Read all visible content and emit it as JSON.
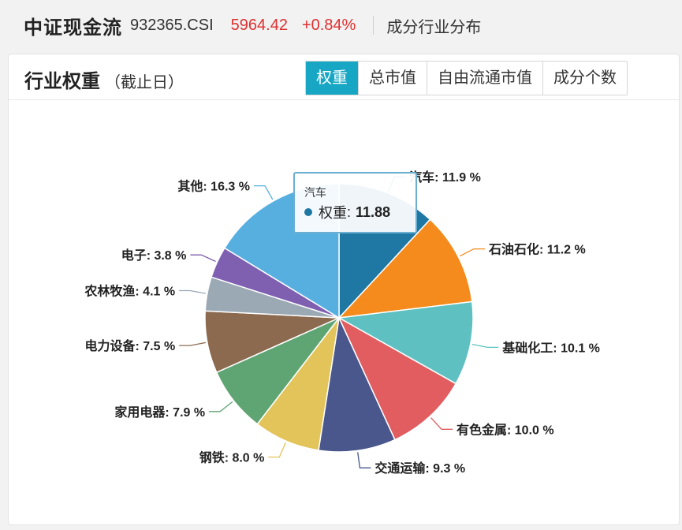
{
  "header": {
    "index_name": "中证现金流",
    "index_code": "932365.CSI",
    "price": "5964.42",
    "change": "+0.84%",
    "section": "成分行业分布"
  },
  "panel": {
    "title": "行业权重",
    "subtitle": "（截止日）",
    "tabs": [
      {
        "label": "权重",
        "active": true
      },
      {
        "label": "总市值",
        "active": false
      },
      {
        "label": "自由流通市值",
        "active": false
      },
      {
        "label": "成分个数",
        "active": false
      }
    ]
  },
  "tooltip": {
    "category": "汽车",
    "series_label": "权重",
    "value": "11.88"
  },
  "colors": {
    "accent": "#17a7c4",
    "up": "#e03030"
  },
  "chart_data": {
    "type": "pie",
    "start_label": "汽车",
    "direction": "clockwise",
    "slices": [
      {
        "label": "汽车",
        "value": 11.9,
        "display": "11.9 %",
        "color": "#1f77a4"
      },
      {
        "label": "石油石化",
        "value": 11.2,
        "display": "11.2 %",
        "color": "#f48b1c"
      },
      {
        "label": "基础化工",
        "value": 10.1,
        "display": "10.1 %",
        "color": "#5fc0c2"
      },
      {
        "label": "有色金属",
        "value": 10.0,
        "display": "10.0 %",
        "color": "#e15d60"
      },
      {
        "label": "交通运输",
        "value": 9.3,
        "display": "9.3 %",
        "color": "#49578c"
      },
      {
        "label": "钢铁",
        "value": 8.0,
        "display": "8.0 %",
        "color": "#e3c45a"
      },
      {
        "label": "家用电器",
        "value": 7.9,
        "display": "7.9 %",
        "color": "#5fa473"
      },
      {
        "label": "电力设备",
        "value": 7.5,
        "display": "7.5 %",
        "color": "#8c6a4f"
      },
      {
        "label": "农林牧渔",
        "value": 4.1,
        "display": "4.1 %",
        "color": "#9ba9b4"
      },
      {
        "label": "电子",
        "value": 3.8,
        "display": "3.8 %",
        "color": "#7f5fb0"
      },
      {
        "label": "其他",
        "value": 16.3,
        "display": "16.3 %",
        "color": "#57afe0"
      }
    ]
  }
}
